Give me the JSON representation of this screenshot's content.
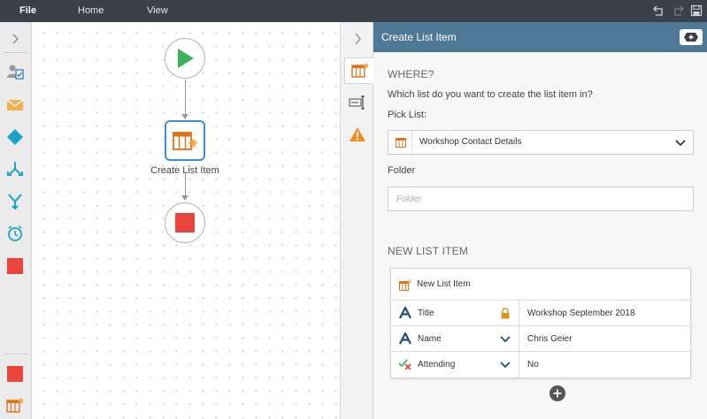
{
  "menu": {
    "file": "File",
    "home": "Home",
    "view": "View"
  },
  "toolbox": {
    "tools": [
      "assign-task-icon",
      "email-icon",
      "condition-icon",
      "branch-icon",
      "merge-icon",
      "timer-icon",
      "stop-icon"
    ],
    "bottom_tools": [
      "stop-icon",
      "create-list-item-icon"
    ]
  },
  "canvas": {
    "action_caption": "Create List Item"
  },
  "panel": {
    "title": "Create List Item",
    "where_title": "WHERE?",
    "where_question": "Which list do you want to create the list item in?",
    "pick_list_label": "Pick List:",
    "pick_list_value": "Workshop Contact Details",
    "folder_label": "Folder",
    "folder_placeholder": "Folder",
    "new_item_title": "NEW LIST ITEM",
    "new_item_header": "New List Item",
    "rows": [
      {
        "name": "Title",
        "value": "Workshop September 2018",
        "action": "lock-icon",
        "type": "text-field-icon"
      },
      {
        "name": "Name",
        "value": "Chris Geier",
        "action": "chevron-down-icon",
        "type": "text-field-icon"
      },
      {
        "name": "Attending",
        "value": "No",
        "action": "chevron-down-icon",
        "type": "yes-no-field-icon"
      }
    ]
  },
  "colors": {
    "menubar": "#3a4148",
    "panel_header": "#4f7896",
    "start_green": "#3cb55a",
    "stop_red": "#e8453c",
    "accent_blue": "#3a8fd6",
    "list_orange": "#e0731a"
  }
}
